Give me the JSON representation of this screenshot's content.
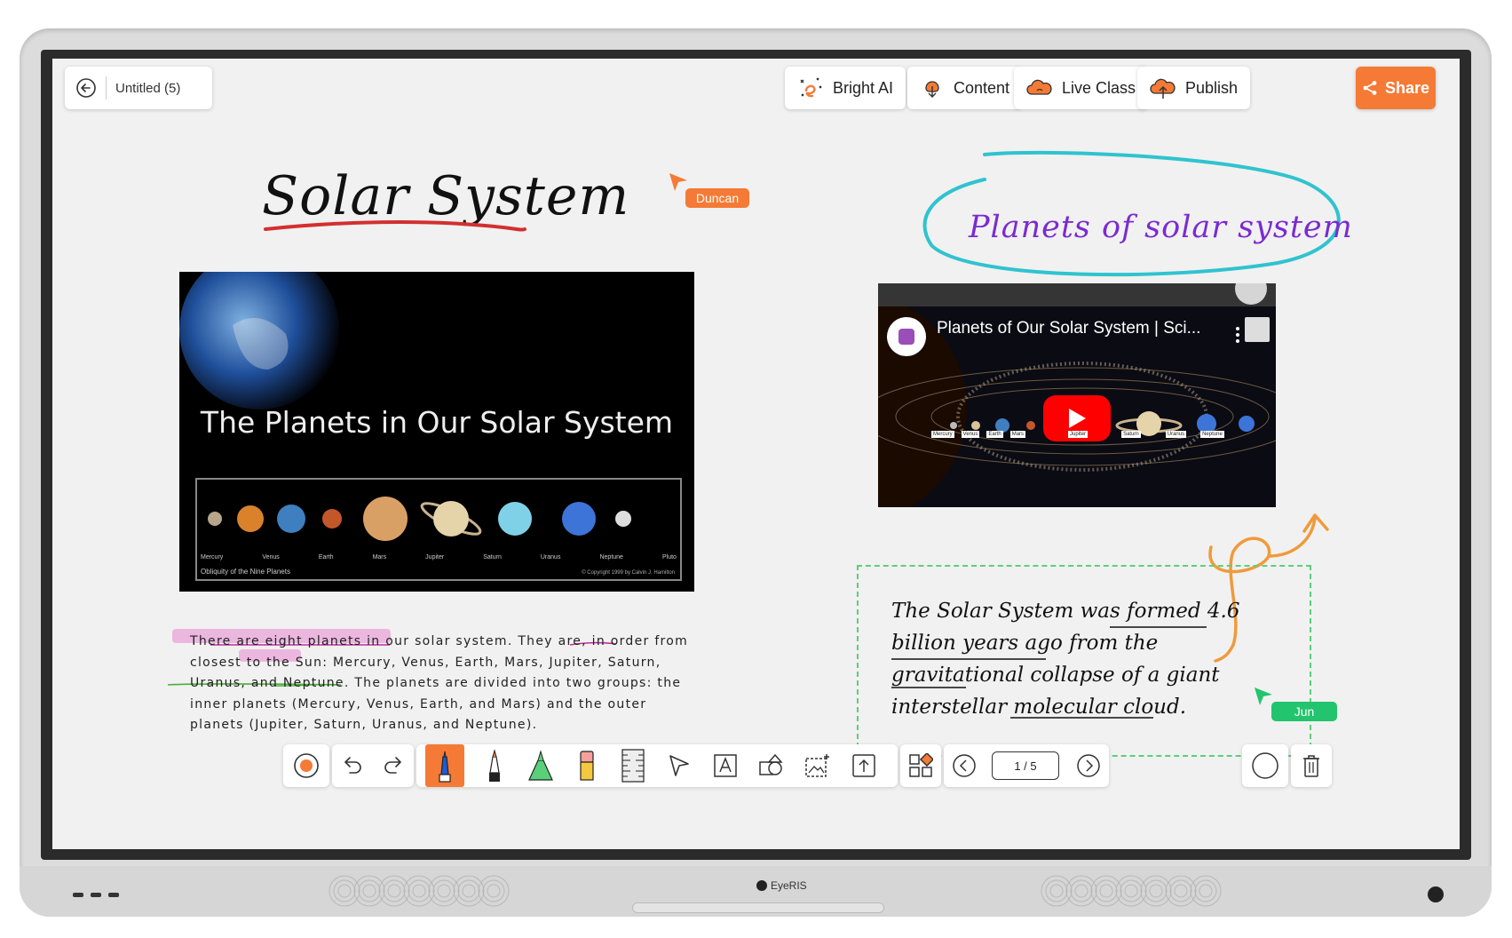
{
  "header": {
    "back_icon": "arrow-left-circle-icon",
    "doc_title": "Untitled (5)",
    "buttons": [
      {
        "label": "Bright AI",
        "icon": "bright-ai-icon"
      },
      {
        "label": "Content",
        "icon": "content-icon"
      },
      {
        "label": "Live Class",
        "icon": "live-class-icon"
      },
      {
        "label": "Publish",
        "icon": "publish-icon"
      }
    ],
    "share_label": "Share",
    "share_color": "#f47a35"
  },
  "board": {
    "title": "Solar System",
    "slide_heading": "The Planets in Our Solar System",
    "slide_caption": "Obliquity of the Nine Planets",
    "slide_copyright": "© Copyright 1999 by Calvin J. Hamilton",
    "planet_labels": [
      "Mercury",
      "Venus",
      "Earth",
      "Mars",
      "Jupiter",
      "Saturn",
      "Uranus",
      "Neptune",
      "Pluto"
    ],
    "paragraph": "There are eight planets in our solar system. They are, in order from closest to the Sun: Mercury, Venus, Earth, Mars, Jupiter, Saturn, Uranus, and Neptune. The planets are divided into two groups: the inner planets (Mercury, Venus, Earth, and Mars) and the outer planets (Jupiter, Saturn, Uranus, and Neptune).",
    "oval_text": "Planets of solar system",
    "video_title": "Planets of Our Solar System | Sci...",
    "video_planet_labels": [
      "Mercury",
      "Venus",
      "Earth",
      "Mars",
      "Jupiter",
      "Saturn",
      "Uranus",
      "Neptune"
    ],
    "note_text": "The Solar System was formed 4.6 billion years ago from the gravitational collapse of a giant interstellar molecular cloud.",
    "cursors": [
      {
        "name": "Duncan",
        "color": "#f47a35"
      },
      {
        "name": "Jun",
        "color": "#22c46e"
      }
    ]
  },
  "toolbar": {
    "tools": [
      "record-icon",
      "undo-icon",
      "redo-icon",
      "marker-icon",
      "pen-icon",
      "highlighter-icon",
      "eraser-icon",
      "ruler-icon",
      "select-icon",
      "text-icon",
      "shapes-icon",
      "image-icon",
      "upload-icon",
      "apps-icon",
      "prev-page-icon",
      "next-page-icon",
      "circle-icon",
      "trash-icon"
    ],
    "page_indicator": "1 / 5",
    "active_color": "#f47a35"
  },
  "device": {
    "brand": "EyeRIS"
  }
}
